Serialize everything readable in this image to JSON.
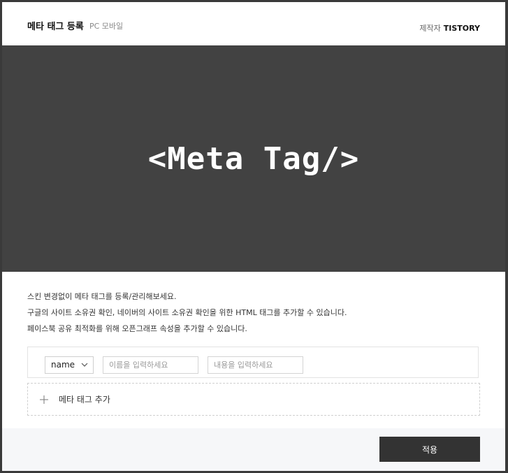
{
  "header": {
    "title": "메타 태그 등록",
    "subtitle": "PC 모바일",
    "maker_label": "제작자",
    "maker_name": "TISTORY"
  },
  "banner": {
    "text": "<Meta Tag/>"
  },
  "description": {
    "line1": "스킨 변경없이 메타 태그를 등록/관리해보세요.",
    "line2": "구글의 사이트 소유권 확인, 네이버의 사이트 소유권 확인을 위한 HTML 태그를 추가할 수 있습니다.",
    "line3": "페이스북 공유 최적화를 위해 오픈그래프 속성을 추가할 수 있습니다."
  },
  "tag_row": {
    "type_selected": "name",
    "name_placeholder": "이름을 입력하세요",
    "content_placeholder": "내용을 입력하세요"
  },
  "add_tag": {
    "label": "메타 태그 추가",
    "icon": "plus-icon"
  },
  "footer": {
    "apply_label": "적용"
  },
  "colors": {
    "banner_bg": "#424242",
    "button_bg": "#333333",
    "footer_bg": "#f6f7f9"
  }
}
